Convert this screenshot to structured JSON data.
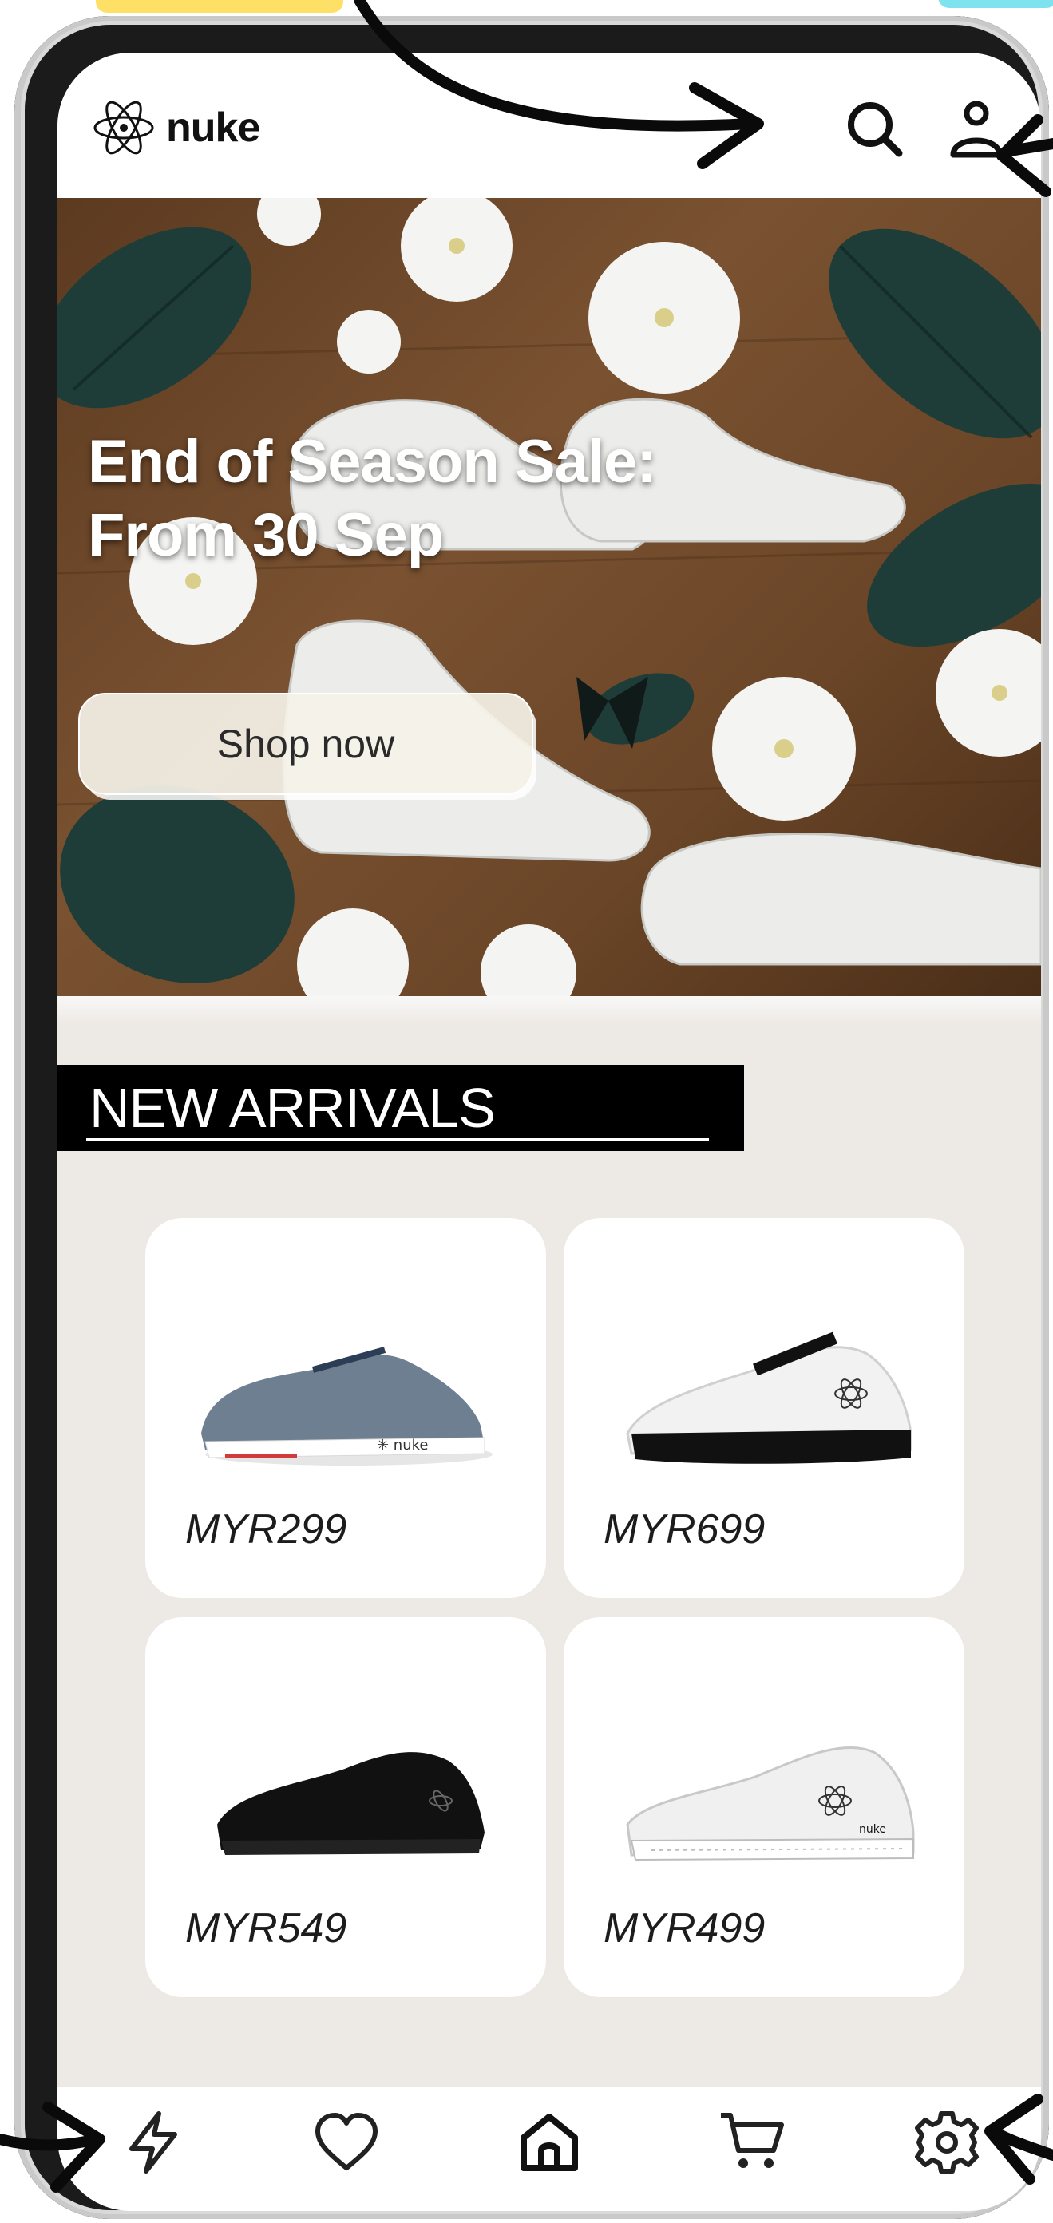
{
  "app": {
    "brand": "nuke"
  },
  "header": {
    "search_icon": "search-icon",
    "account_icon": "user-icon"
  },
  "hero": {
    "title_line1": "End of Season Sale:",
    "title_line2": "From 30 Sep",
    "cta_label": "Shop now"
  },
  "new_arrivals": {
    "heading": "NEW ARRIVALS",
    "products": [
      {
        "price": "MYR299",
        "shoe_color": "#6f7f92"
      },
      {
        "price": "MYR699",
        "shoe_color": "#f2f2f2"
      },
      {
        "price": "MYR549",
        "shoe_color": "#111111"
      },
      {
        "price": "MYR499",
        "shoe_color": "#f0f0f0"
      }
    ]
  },
  "bottom_nav": {
    "items": [
      "lightning-icon",
      "heart-icon",
      "home-icon",
      "cart-icon",
      "settings-icon"
    ]
  },
  "colors": {
    "background": "#ede9e4",
    "header": "#ffffff",
    "label_bg": "#000000"
  }
}
